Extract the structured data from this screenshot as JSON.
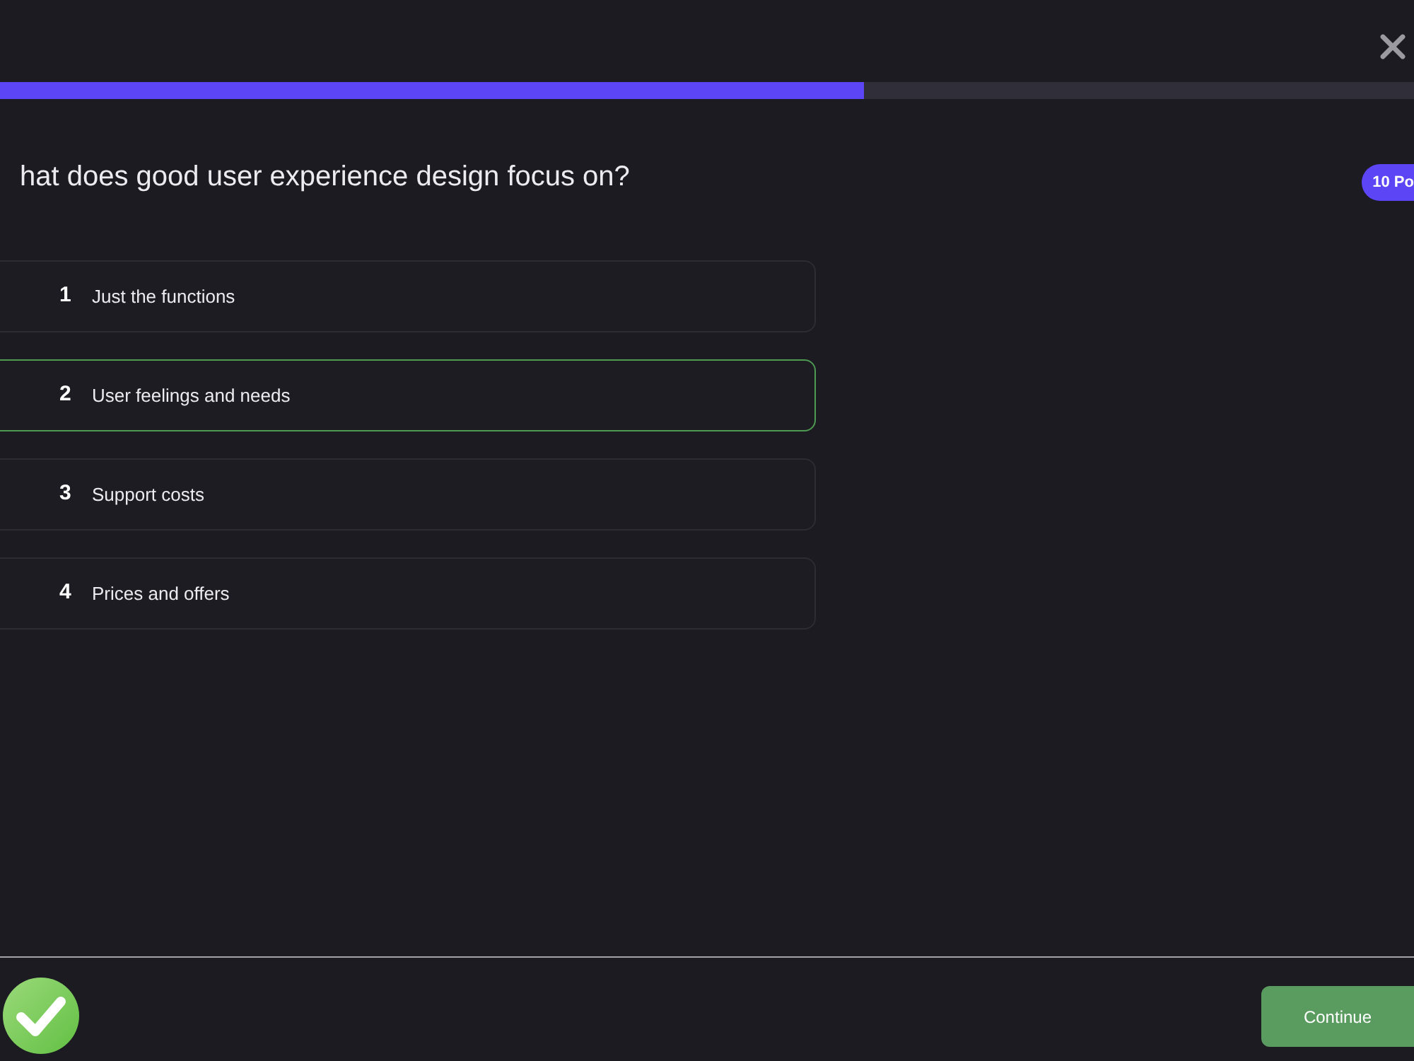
{
  "progress": {
    "level": 0.611
  },
  "question": {
    "text": "hat does good user experience design focus on?",
    "points": "10 Po"
  },
  "options": [
    {
      "number": "1",
      "label": "Just the functions",
      "selected": false
    },
    {
      "number": "2",
      "label": "User feelings and needs",
      "selected": true
    },
    {
      "number": "3",
      "label": "Support costs",
      "selected": false
    },
    {
      "number": "4",
      "label": "Prices and offers",
      "selected": false
    }
  ],
  "footer": {
    "answer_correct": true,
    "button": "Continue"
  }
}
